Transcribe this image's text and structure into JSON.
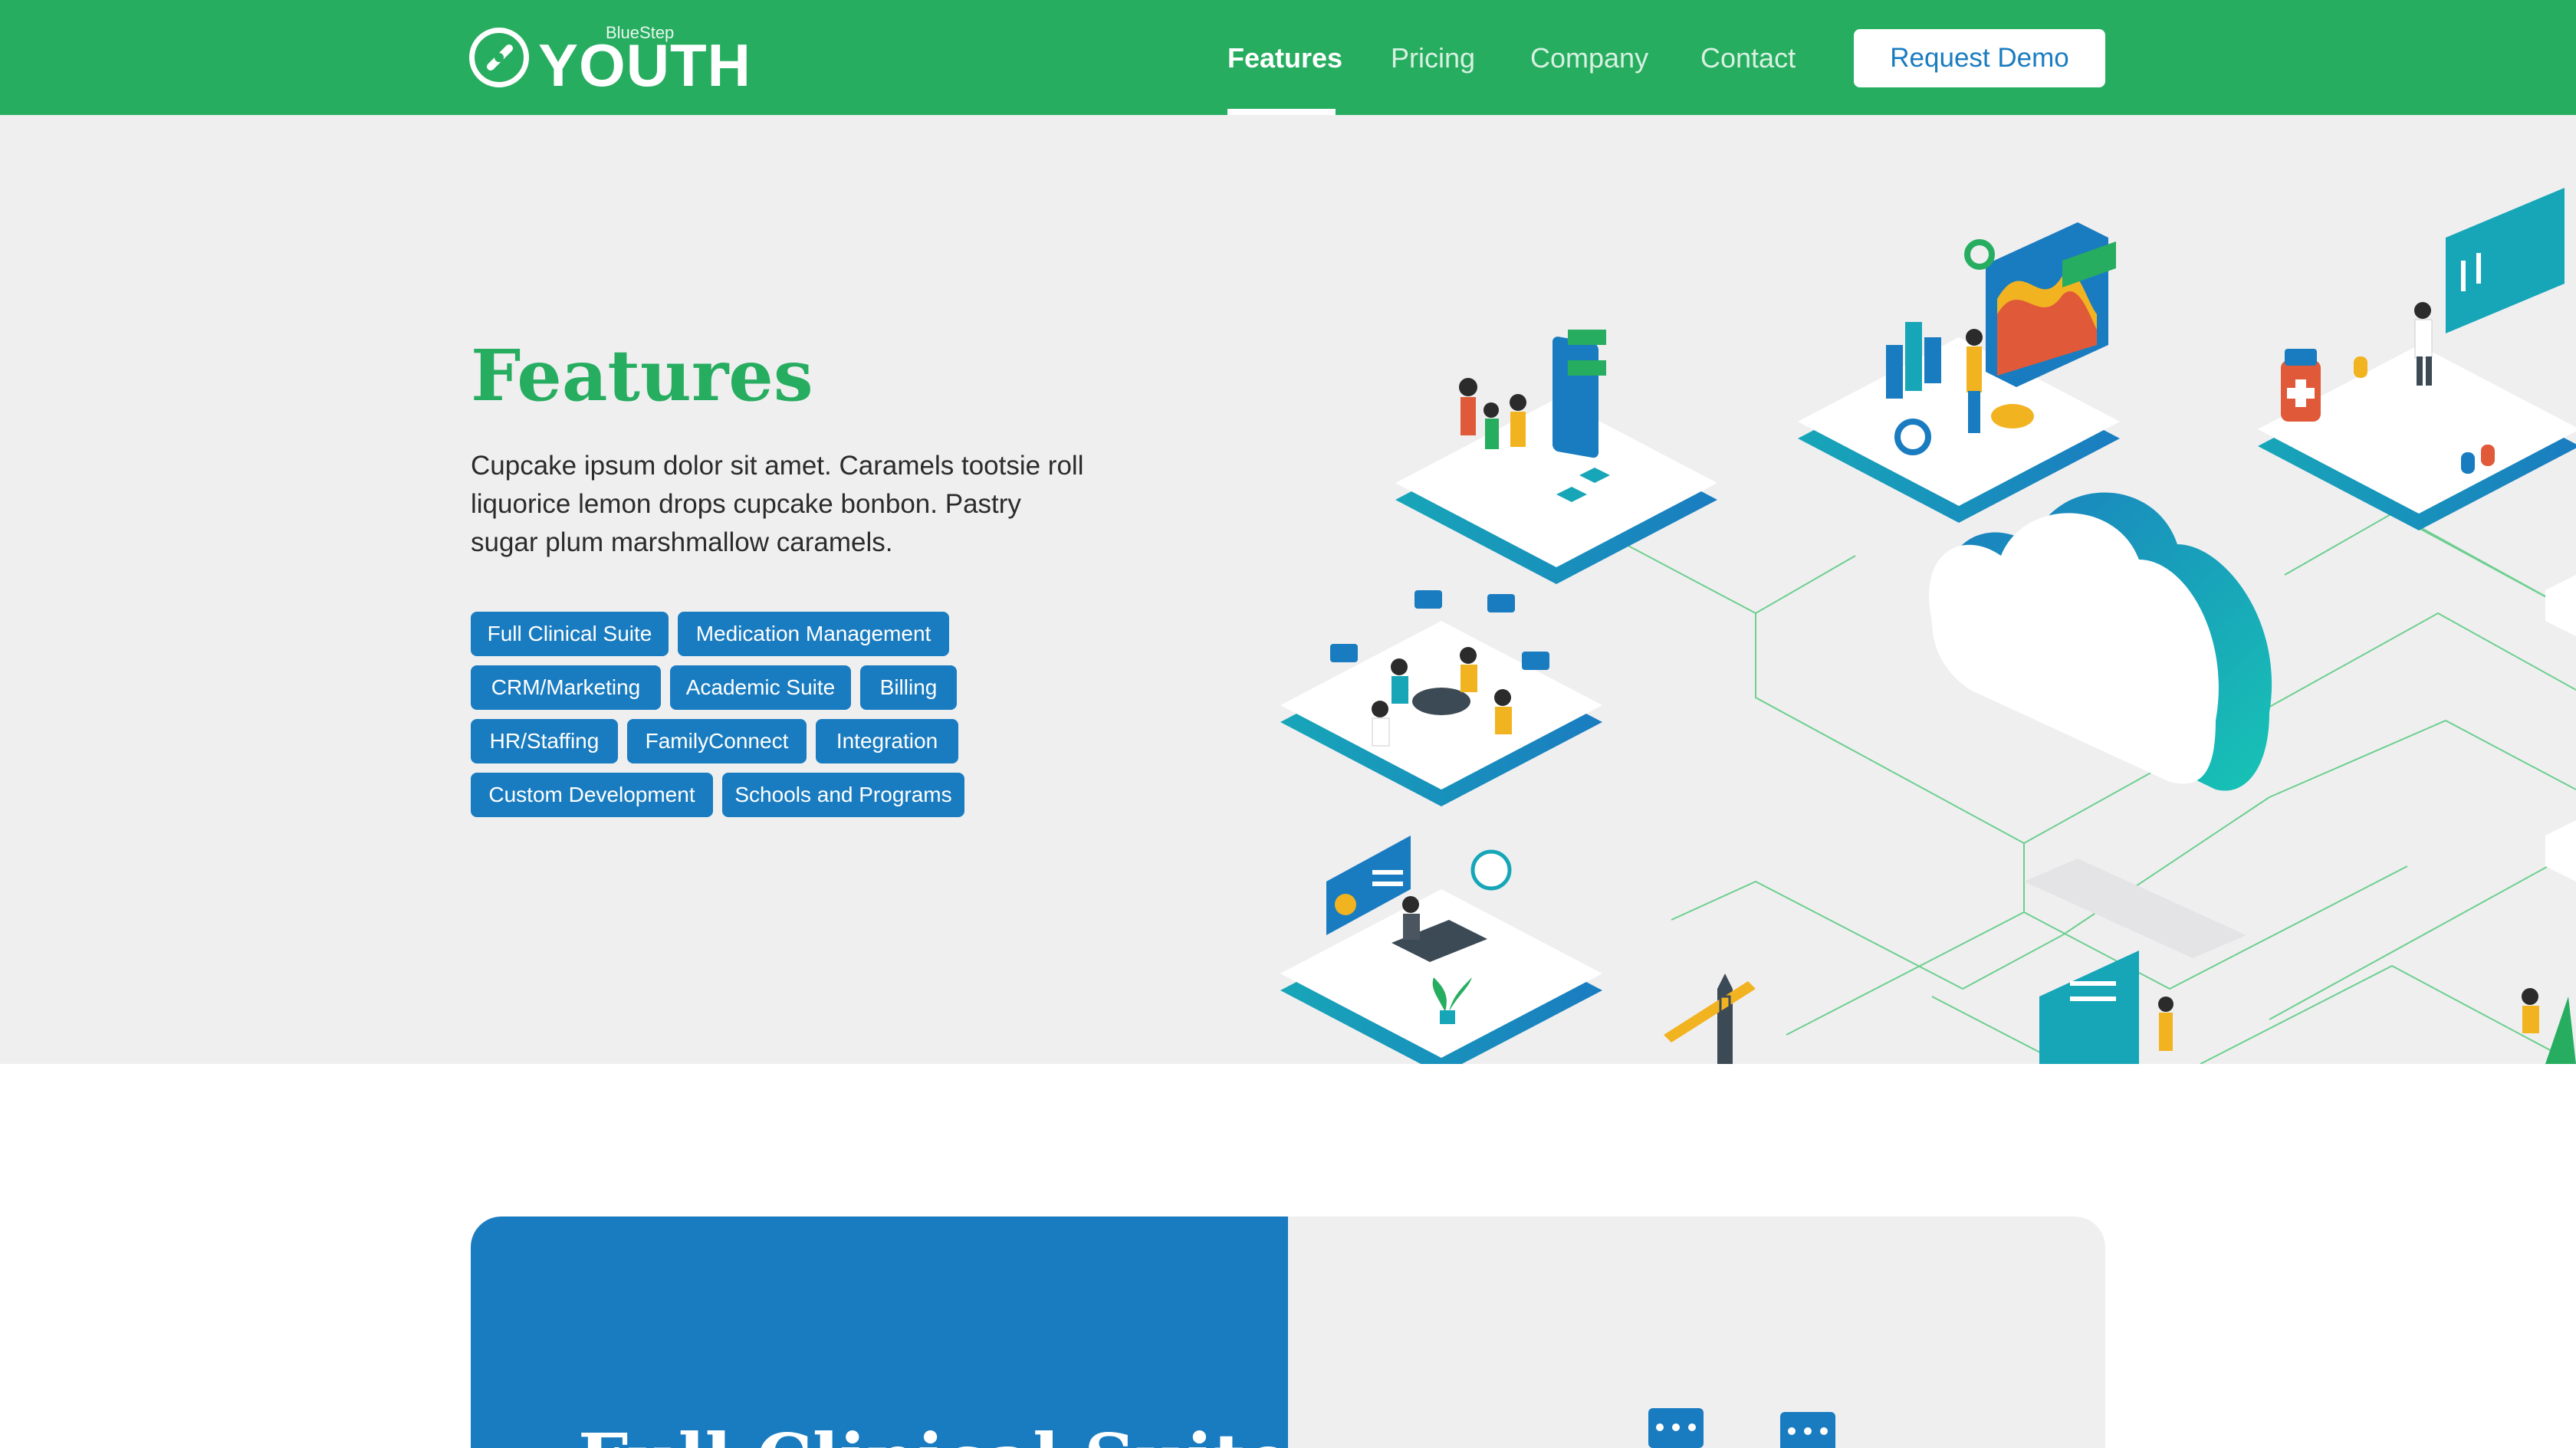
{
  "nav": {
    "logo_small": "BlueStep",
    "logo_big": "YOUTH",
    "links": [
      "Features",
      "Pricing",
      "Company",
      "Contact"
    ],
    "cta": "Request Demo",
    "active": "Features"
  },
  "hero": {
    "title": "Features",
    "description": "Cupcake ipsum dolor sit amet. Caramels tootsie roll liquorice lemon drops cupcake bonbon. Pastry sugar plum marshmallow caramels.",
    "tags": [
      "Full Clinical Suite",
      "Medication Management",
      "CRM/Marketing",
      "Academic Suite",
      "Billing",
      "HR/Staffing",
      "FamilyConnect",
      "Integration",
      "Custom Development",
      "Schools and Programs"
    ]
  },
  "section": {
    "title": "Full Clinical Suite"
  },
  "colors": {
    "brand_green": "#27ad60",
    "brand_blue": "#1a7cc0",
    "teal": "#17b4b4",
    "hero_bg": "#efeff0"
  }
}
